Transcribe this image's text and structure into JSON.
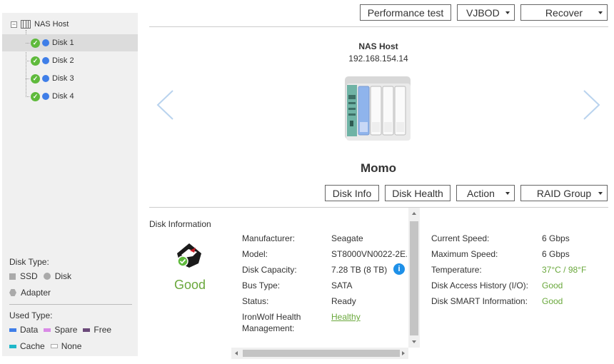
{
  "sidebar": {
    "root_label": "NAS Host",
    "items": [
      {
        "label": "Disk 1",
        "selected": true
      },
      {
        "label": "Disk 2",
        "selected": false
      },
      {
        "label": "Disk 3",
        "selected": false
      },
      {
        "label": "Disk 4",
        "selected": false
      }
    ],
    "legend": {
      "disk_type_title": "Disk Type:",
      "ssd": "SSD",
      "disk": "Disk",
      "adapter": "Adapter",
      "used_type_title": "Used Type:",
      "data": "Data",
      "spare": "Spare",
      "free": "Free",
      "cache": "Cache",
      "none": "None",
      "colors": {
        "data": "#3f7ee8",
        "spare": "#d98ae6",
        "free": "#6b4a7a",
        "cache": "#1fb7c9"
      }
    }
  },
  "toolbar": {
    "performance_test": "Performance test",
    "vjbod": "VJBOD",
    "recover": "Recover"
  },
  "device": {
    "name": "NAS Host",
    "ip": "192.168.154.14",
    "disk_name": "Momo"
  },
  "disk_tabs": {
    "disk_info": "Disk Info",
    "disk_health": "Disk Health",
    "action": "Action",
    "raid_group": "RAID Group"
  },
  "info": {
    "title": "Disk Information",
    "status": "Good",
    "left": {
      "manufacturer_label": "Manufacturer:",
      "manufacturer": "Seagate",
      "model_label": "Model:",
      "model": "ST8000VN0022-2E...",
      "capacity_label": "Disk Capacity:",
      "capacity": "7.28 TB (8 TB)",
      "bus_label": "Bus Type:",
      "bus": "SATA",
      "status_label": "Status:",
      "status": "Ready",
      "ironwolf_label_1": "IronWolf Health",
      "ironwolf_label_2": "Management:",
      "ironwolf": "Healthy"
    },
    "right": {
      "current_speed_label": "Current Speed:",
      "current_speed": "6 Gbps",
      "max_speed_label": "Maximum Speed:",
      "max_speed": "6 Gbps",
      "temperature_label": "Temperature:",
      "temperature": "37°C / 98°F",
      "access_label": "Disk Access History (I/O):",
      "access": "Good",
      "smart_label": "Disk SMART Information:",
      "smart": "Good"
    }
  },
  "colors": {
    "accent_green": "#6aa83c",
    "info_blue": "#1e90e8",
    "disk_blue": "#3f7ee8"
  }
}
